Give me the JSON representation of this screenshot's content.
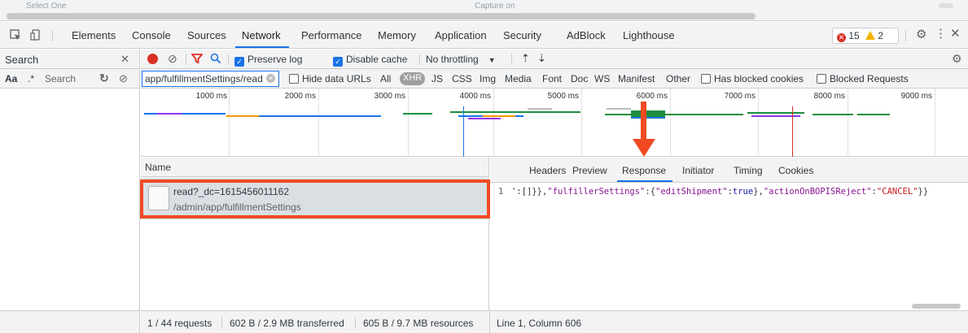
{
  "top_strip": {
    "left_faded": "Select One",
    "center_faded": "Capture on"
  },
  "tabs": [
    "Elements",
    "Console",
    "Sources",
    "Network",
    "Performance",
    "Memory",
    "Application",
    "Security",
    "AdBlock",
    "Lighthouse"
  ],
  "active_tab": "Network",
  "issues": {
    "errors": "15",
    "warnings": "2"
  },
  "search_panel": {
    "title": "Search",
    "aa": "Aa",
    "regex": ".*",
    "placeholder": "Search"
  },
  "toolbar": {
    "preserve_log": "Preserve log",
    "disable_cache": "Disable cache",
    "throttling": "No throttling"
  },
  "filter": {
    "value": "app/fulfillmentSettings/read",
    "hide_data_urls": "Hide data URLs",
    "types": [
      "All",
      "XHR",
      "JS",
      "CSS",
      "Img",
      "Media",
      "Font",
      "Doc",
      "WS",
      "Manifest",
      "Other"
    ],
    "active_type": "XHR",
    "has_blocked_cookies": "Has blocked cookies",
    "blocked_requests": "Blocked Requests"
  },
  "timeline": {
    "ticks": [
      "1000 ms",
      "2000 ms",
      "3000 ms",
      "4000 ms",
      "5000 ms",
      "6000 ms",
      "7000 ms",
      "8000 ms",
      "9000 ms"
    ]
  },
  "request_list": {
    "header": "Name",
    "rows": [
      {
        "name": "read?_dc=1615456011162",
        "path": "/admin/app/fulfillmentSettings"
      }
    ]
  },
  "detail_tabs": [
    "Headers",
    "Preview",
    "Response",
    "Initiator",
    "Timing",
    "Cookies"
  ],
  "active_detail_tab": "Response",
  "response": {
    "line_number": "1",
    "p1": "':[]}},",
    "k1": "\"fulfillerSettings\"",
    "p2": ":{",
    "k2": "\"editShipment\"",
    "p3": ":",
    "v1": "true",
    "p4": "},",
    "k3": "\"actionOnBOPISReject\"",
    "p5": ":",
    "s1": "\"CANCEL\"",
    "p6": "}}"
  },
  "status": {
    "requests": "1 / 44 requests",
    "transferred": "602 B / 2.9 MB transferred",
    "resources": "605 B / 9.7 MB resources",
    "cursor": "Line 1, Column 606"
  },
  "colors": {
    "accent": "#1a73e8",
    "annotation": "#f04a23",
    "error": "#d93025",
    "warning": "#f4b400"
  }
}
